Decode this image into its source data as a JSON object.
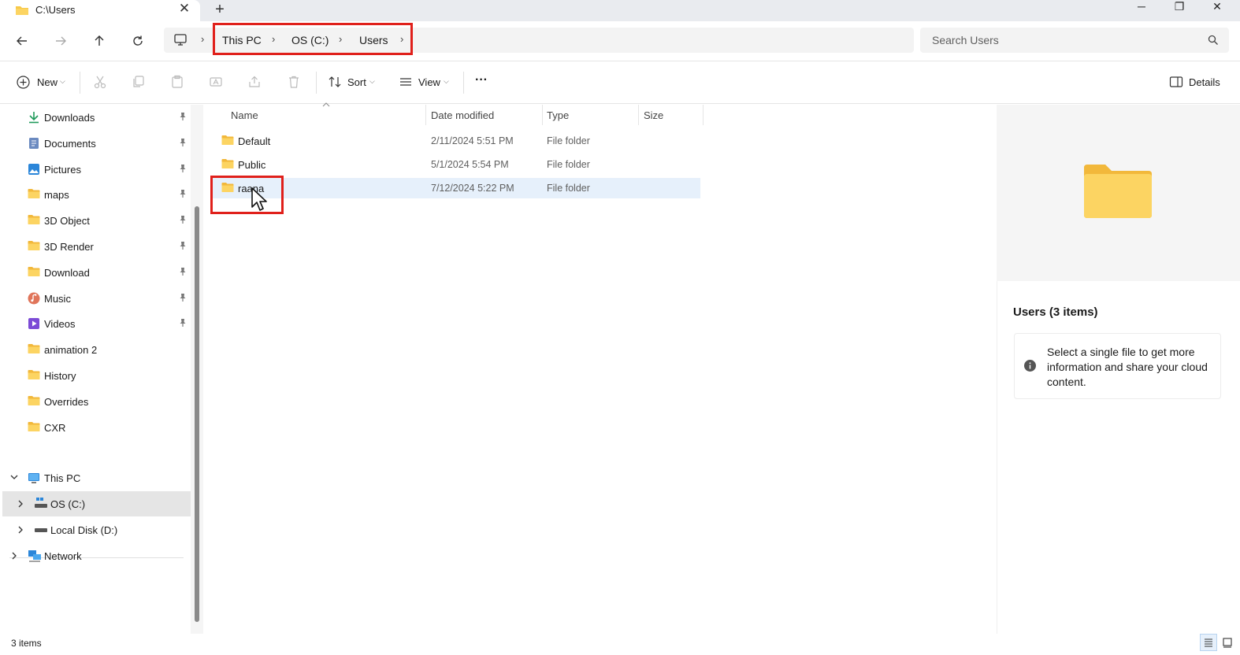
{
  "window": {
    "tab_title": "C:\\Users",
    "tab_close": "✕",
    "new_tab": "+",
    "minimize": "─",
    "restore": "❐",
    "close": "✕"
  },
  "address": {
    "crumbs": [
      "This PC",
      "OS (C:)",
      "Users"
    ],
    "search_placeholder": "Search Users"
  },
  "toolbar": {
    "new_label": "New",
    "sort_label": "Sort",
    "view_label": "View",
    "more_label": "···",
    "details_label": "Details"
  },
  "sidebar": {
    "quick_access": [
      {
        "label": "Downloads",
        "icon": "download-arrow-icon"
      },
      {
        "label": "Documents",
        "icon": "document-icon"
      },
      {
        "label": "Pictures",
        "icon": "pictures-icon"
      },
      {
        "label": "maps",
        "icon": "folder-icon"
      },
      {
        "label": "3D Object",
        "icon": "folder-icon"
      },
      {
        "label": "3D Render",
        "icon": "folder-icon"
      },
      {
        "label": "Download",
        "icon": "folder-icon"
      },
      {
        "label": "Music",
        "icon": "music-icon"
      },
      {
        "label": "Videos",
        "icon": "videos-icon"
      },
      {
        "label": "animation 2",
        "icon": "folder-icon"
      },
      {
        "label": "History",
        "icon": "folder-icon"
      },
      {
        "label": "Overrides",
        "icon": "folder-icon"
      },
      {
        "label": "CXR",
        "icon": "folder-icon"
      }
    ],
    "this_pc": "This PC",
    "drive_c": "OS (C:)",
    "drive_d": "Local Disk (D:)",
    "network": "Network"
  },
  "columns": {
    "name": "Name",
    "date": "Date modified",
    "type": "Type",
    "size": "Size"
  },
  "files": [
    {
      "name": "Default",
      "date": "2/11/2024 5:51 PM",
      "type": "File folder",
      "size": ""
    },
    {
      "name": "Public",
      "date": "5/1/2024 5:54 PM",
      "type": "File folder",
      "size": ""
    },
    {
      "name": "raana",
      "date": "7/12/2024 5:22 PM",
      "type": "File folder",
      "size": ""
    }
  ],
  "details": {
    "title": "Users (3 items)",
    "info_text": "Select a single file to get more information and share your cloud content."
  },
  "status": {
    "count": "3 items"
  },
  "colors": {
    "folder": "#f7c948",
    "highlight": "#e0201b",
    "selection": "#e6f0fb"
  }
}
